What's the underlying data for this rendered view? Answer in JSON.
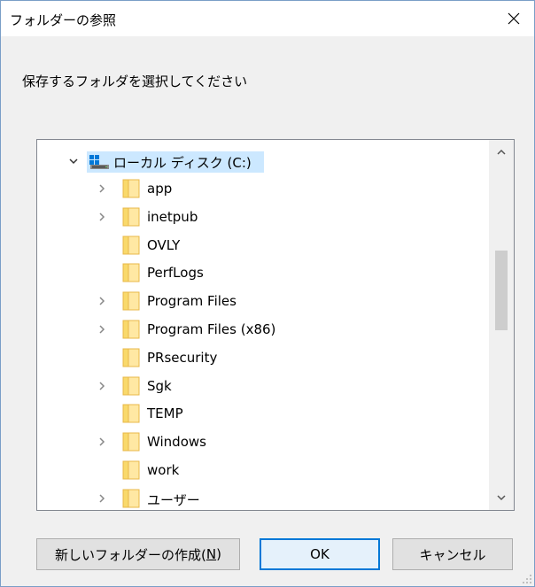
{
  "window": {
    "title": "フォルダーの参照",
    "instruction": "保存するフォルダを選択してください"
  },
  "tree": {
    "root": {
      "label": "ローカル ディスク (C:)",
      "expanded": true,
      "selected": true,
      "icon": "drive-icon"
    },
    "items": [
      {
        "label": "app",
        "has_children": true
      },
      {
        "label": "inetpub",
        "has_children": true
      },
      {
        "label": "OVLY",
        "has_children": false
      },
      {
        "label": "PerfLogs",
        "has_children": false
      },
      {
        "label": "Program Files",
        "has_children": true
      },
      {
        "label": "Program Files (x86)",
        "has_children": true
      },
      {
        "label": "PRsecurity",
        "has_children": false
      },
      {
        "label": "Sgk",
        "has_children": true
      },
      {
        "label": "TEMP",
        "has_children": false
      },
      {
        "label": "Windows",
        "has_children": true
      },
      {
        "label": "work",
        "has_children": false
      },
      {
        "label": "ユーザー",
        "has_children": true
      }
    ]
  },
  "buttons": {
    "new_folder": "新しいフォルダーの作成(",
    "new_folder_key": "N",
    "new_folder_end": ")",
    "ok": "OK",
    "cancel": "キャンセル"
  },
  "colors": {
    "selection": "#cce8ff",
    "folder_fill": "#ffe8a3",
    "folder_edge": "#e8b84a",
    "focus_border": "#0078d7"
  }
}
